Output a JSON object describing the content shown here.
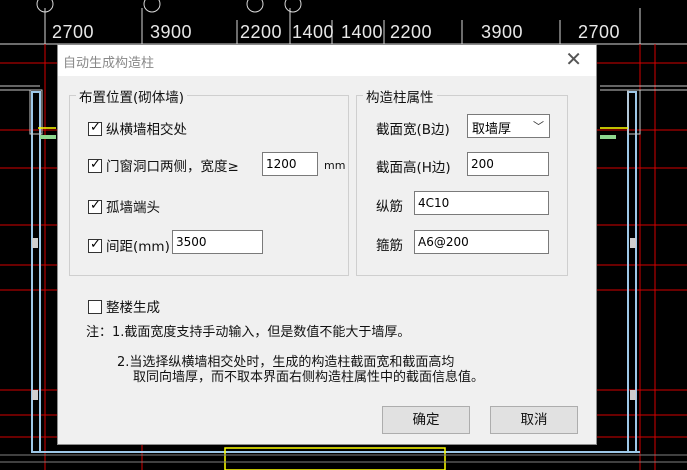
{
  "background": {
    "dimensions": [
      "2700",
      "3900",
      "2200",
      "1400",
      "1400",
      "2200",
      "3900",
      "2700"
    ]
  },
  "dialog": {
    "title": "自动生成构造柱",
    "placement_group": {
      "title": "布置位置(砌体墙)",
      "cross_walls": {
        "label": "纵横墙相交处",
        "checked": true
      },
      "opening_sides": {
        "label": "门窗洞口两侧，宽度≥",
        "checked": true,
        "value": "1200",
        "unit": "mm"
      },
      "isolated_wall_end": {
        "label": "孤墙端头",
        "checked": true
      },
      "spacing": {
        "label": "间距(mm)",
        "checked": true,
        "value": "3500"
      }
    },
    "column_props": {
      "title": "构造柱属性",
      "width_label": "截面宽(B边)",
      "width_value": "取墙厚",
      "height_label": "截面高(H边)",
      "height_value": "200",
      "long_rebar_label": "纵筋",
      "long_rebar_value": "4C10",
      "stirrup_label": "箍筋",
      "stirrup_value": "A6@200"
    },
    "whole_building": {
      "label": "整楼生成",
      "checked": false
    },
    "notes": {
      "line1": "注：1.截面宽度支持手动输入，但是数值不能大于墙厚。",
      "line2": "2.当选择纵横墙相交处时，生成的构造柱截面宽和截面高均",
      "line3": "取同向墙厚，而不取本界面右侧构造柱属性中的截面信息值。"
    },
    "ok_label": "确定",
    "cancel_label": "取消"
  }
}
